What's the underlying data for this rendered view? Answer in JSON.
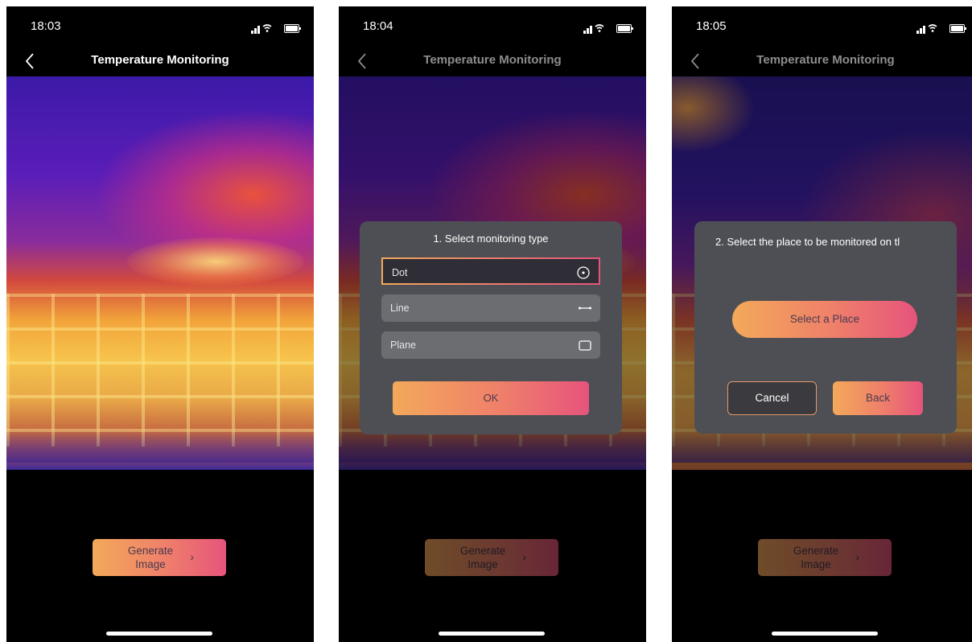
{
  "screens": [
    {
      "status": {
        "time": "18:03"
      },
      "nav": {
        "title": "Temperature Monitoring"
      },
      "generate_button": {
        "label": "Generate Image"
      }
    },
    {
      "status": {
        "time": "18:04"
      },
      "nav": {
        "title": "Temperature Monitoring"
      },
      "dialog": {
        "title": "1. Select monitoring type",
        "options": [
          {
            "label": "Dot",
            "icon": "target-dot-icon",
            "selected": true
          },
          {
            "label": "Line",
            "icon": "line-icon",
            "selected": false
          },
          {
            "label": "Plane",
            "icon": "rectangle-icon",
            "selected": false
          }
        ],
        "ok_label": "OK"
      },
      "generate_button": {
        "label": "Generate Image"
      }
    },
    {
      "status": {
        "time": "18:05"
      },
      "nav": {
        "title": "Temperature Monitoring"
      },
      "dialog": {
        "title": "2. Select the place to be monitored on tl",
        "select_place_label": "Select a Place",
        "cancel_label": "Cancel",
        "back_label": "Back"
      },
      "generate_button": {
        "label": "Generate Image"
      }
    }
  ],
  "colors": {
    "accent_start": "#f3a95a",
    "accent_end": "#e6547c",
    "dialog_bg": "#4e4f54",
    "option_bg": "#6c6d71"
  }
}
